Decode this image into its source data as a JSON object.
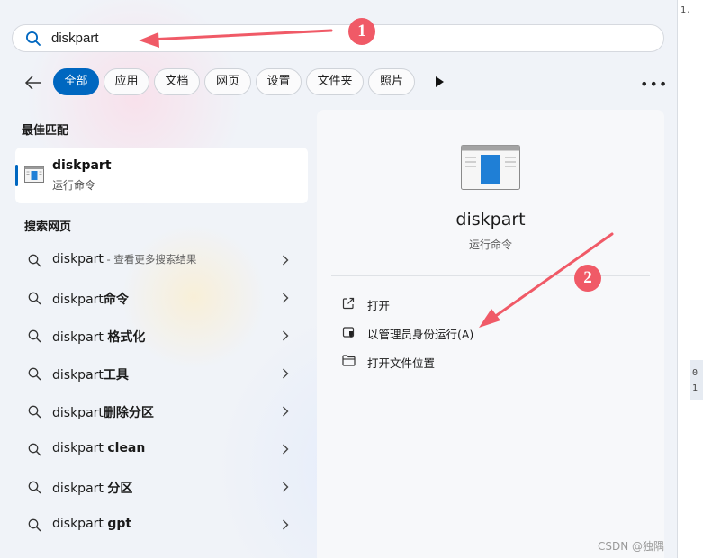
{
  "search": {
    "query": "diskpart"
  },
  "filters": {
    "items": [
      {
        "label": "全部",
        "active": true
      },
      {
        "label": "应用",
        "active": false
      },
      {
        "label": "文档",
        "active": false
      },
      {
        "label": "网页",
        "active": false
      },
      {
        "label": "设置",
        "active": false
      },
      {
        "label": "文件夹",
        "active": false
      },
      {
        "label": "照片",
        "active": false
      }
    ]
  },
  "best_match": {
    "heading": "最佳匹配",
    "name": "diskpart",
    "subtitle": "运行命令"
  },
  "web": {
    "heading": "搜索网页",
    "results": [
      {
        "prefix": "diskpart",
        "bold": "",
        "note": " - 查看更多搜索结果"
      },
      {
        "prefix": "diskpart",
        "bold": "命令",
        "note": ""
      },
      {
        "prefix": "diskpart ",
        "bold": "格式化",
        "note": ""
      },
      {
        "prefix": "diskpart",
        "bold": "工具",
        "note": ""
      },
      {
        "prefix": "diskpart",
        "bold": "删除分区",
        "note": ""
      },
      {
        "prefix": "diskpart ",
        "bold": "clean",
        "note": ""
      },
      {
        "prefix": "diskpart ",
        "bold": "分区",
        "note": ""
      },
      {
        "prefix": "diskpart ",
        "bold": "gpt",
        "note": ""
      }
    ]
  },
  "detail": {
    "name": "diskpart",
    "subtitle": "运行命令",
    "actions": [
      {
        "label": "打开",
        "icon": "open-external-icon"
      },
      {
        "label": "以管理员身份运行(A)",
        "icon": "shield-icon"
      },
      {
        "label": "打开文件位置",
        "icon": "folder-icon"
      }
    ]
  },
  "annotations": {
    "badge1": "1",
    "badge2": "2",
    "color": "#f05a67"
  },
  "side_strip": {
    "line1": "1.",
    "line2": "0",
    "line3": "1"
  },
  "watermark": "CSDN @独隅",
  "colors": {
    "accent": "#0067c0"
  }
}
